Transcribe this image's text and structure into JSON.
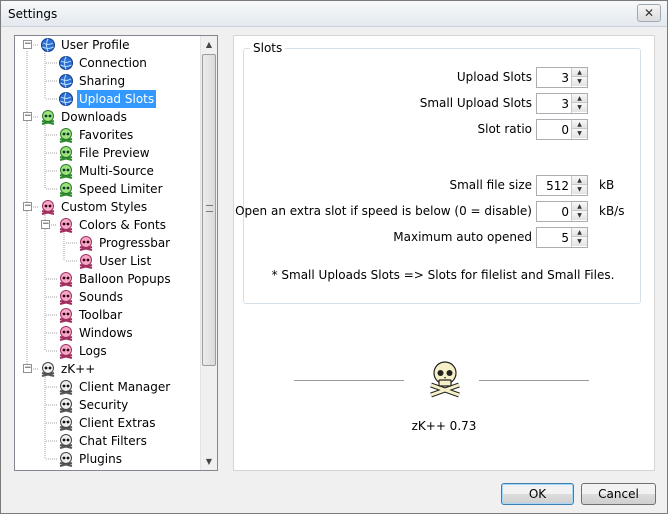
{
  "window": {
    "title": "Settings",
    "close_glyph": "✕"
  },
  "tree": {
    "items": [
      {
        "label": "User Profile",
        "icon": "globe-icon",
        "level": 0,
        "expander": "−"
      },
      {
        "label": "Connection",
        "icon": "globe-icon",
        "level": 1
      },
      {
        "label": "Sharing",
        "icon": "globe-icon",
        "level": 1
      },
      {
        "label": "Upload Slots",
        "icon": "globe-icon",
        "level": 1,
        "selected": true
      },
      {
        "label": "Downloads",
        "icon": "green-skull-icon",
        "level": 0,
        "expander": "−"
      },
      {
        "label": "Favorites",
        "icon": "green-skull-icon",
        "level": 1
      },
      {
        "label": "File Preview",
        "icon": "green-skull-icon",
        "level": 1
      },
      {
        "label": "Multi-Source",
        "icon": "green-skull-icon",
        "level": 1
      },
      {
        "label": "Speed Limiter",
        "icon": "green-skull-icon",
        "level": 1
      },
      {
        "label": "Custom Styles",
        "icon": "pink-skull-icon",
        "level": 0,
        "expander": "−"
      },
      {
        "label": "Colors & Fonts",
        "icon": "pink-skull-icon",
        "level": 1,
        "expander": "−"
      },
      {
        "label": "Progressbar",
        "icon": "pink-skull-icon",
        "level": 2
      },
      {
        "label": "User List",
        "icon": "pink-skull-icon",
        "level": 2
      },
      {
        "label": "Balloon Popups",
        "icon": "pink-skull-icon",
        "level": 1
      },
      {
        "label": "Sounds",
        "icon": "pink-skull-icon",
        "level": 1
      },
      {
        "label": "Toolbar",
        "icon": "pink-skull-icon",
        "level": 1
      },
      {
        "label": "Windows",
        "icon": "pink-skull-icon",
        "level": 1
      },
      {
        "label": "Logs",
        "icon": "pink-skull-icon",
        "level": 1
      },
      {
        "label": "zK++",
        "icon": "crossbones-icon",
        "level": 0,
        "expander": "−"
      },
      {
        "label": "Client Manager",
        "icon": "crossbones-icon",
        "level": 1
      },
      {
        "label": "Security",
        "icon": "crossbones-icon",
        "level": 1
      },
      {
        "label": "Client Extras",
        "icon": "crossbones-icon",
        "level": 1
      },
      {
        "label": "Chat Filters",
        "icon": "crossbones-icon",
        "level": 1
      },
      {
        "label": "Plugins",
        "icon": "crossbones-icon",
        "level": 1
      }
    ]
  },
  "slots": {
    "legend": "Slots",
    "rows": [
      {
        "label": "Upload Slots",
        "value": "3",
        "unit": ""
      },
      {
        "label": "Small Upload Slots",
        "value": "3",
        "unit": ""
      },
      {
        "label": "Slot ratio",
        "value": "0",
        "unit": ""
      },
      {
        "label": "Small file size",
        "value": "512",
        "unit": "kB"
      },
      {
        "label": "Open an extra slot if speed is below (0 = disable)",
        "value": "0",
        "unit": "kB/s"
      },
      {
        "label": "Maximum auto opened",
        "value": "5",
        "unit": ""
      }
    ],
    "note": "* Small Uploads Slots => Slots for filelist and Small Files."
  },
  "about": {
    "icon": "skull-crossbones-icon",
    "version": "zK++ 0.73"
  },
  "buttons": {
    "ok": "OK",
    "cancel": "Cancel"
  },
  "colors": {
    "selection": "#3399ff",
    "panel_bg": "#ffffff",
    "window_bg": "#f0f0f0"
  }
}
